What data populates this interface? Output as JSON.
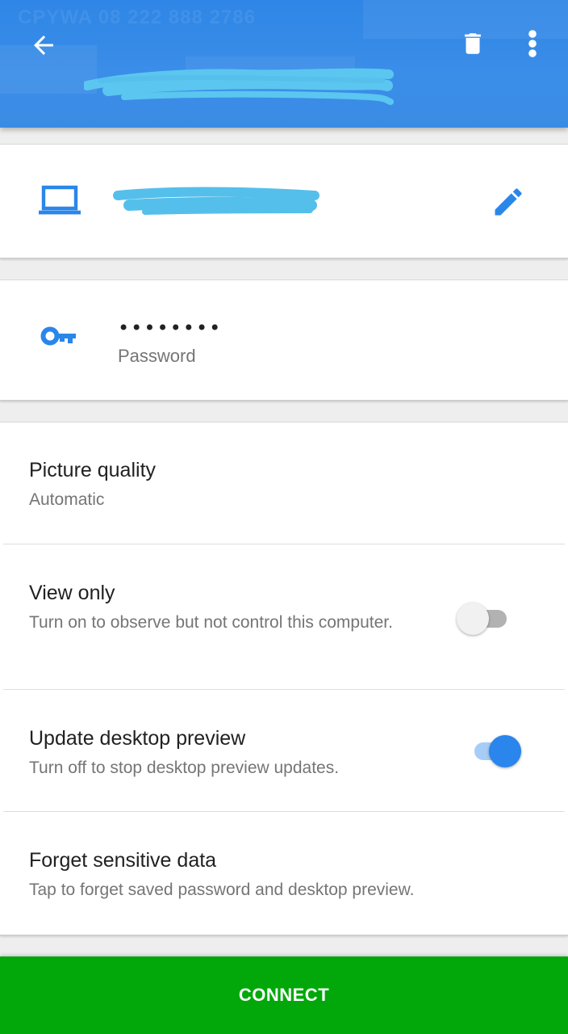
{
  "header": {
    "background_text": "CPYWA 08 222 888 2786",
    "back_icon": "arrow-back-icon",
    "delete_icon": "trash-icon",
    "more_icon": "more-vert-icon",
    "accent_color": "#3a8be4"
  },
  "host": {
    "icon": "laptop-icon",
    "edit_icon": "pencil-icon"
  },
  "password": {
    "icon": "key-icon",
    "value": "••••••••",
    "label": "Password"
  },
  "settings": [
    {
      "title": "Picture quality",
      "subtitle": "Automatic"
    },
    {
      "title": "View only",
      "subtitle": "Turn on to observe but not control this computer.",
      "toggle": false
    },
    {
      "title": "Update desktop preview",
      "subtitle": "Turn off to stop desktop preview updates.",
      "toggle": true
    },
    {
      "title": "Forget sensitive data",
      "subtitle": "Tap to forget saved password and desktop preview."
    }
  ],
  "connect": {
    "label": "CONNECT",
    "color": "#02a80a"
  }
}
